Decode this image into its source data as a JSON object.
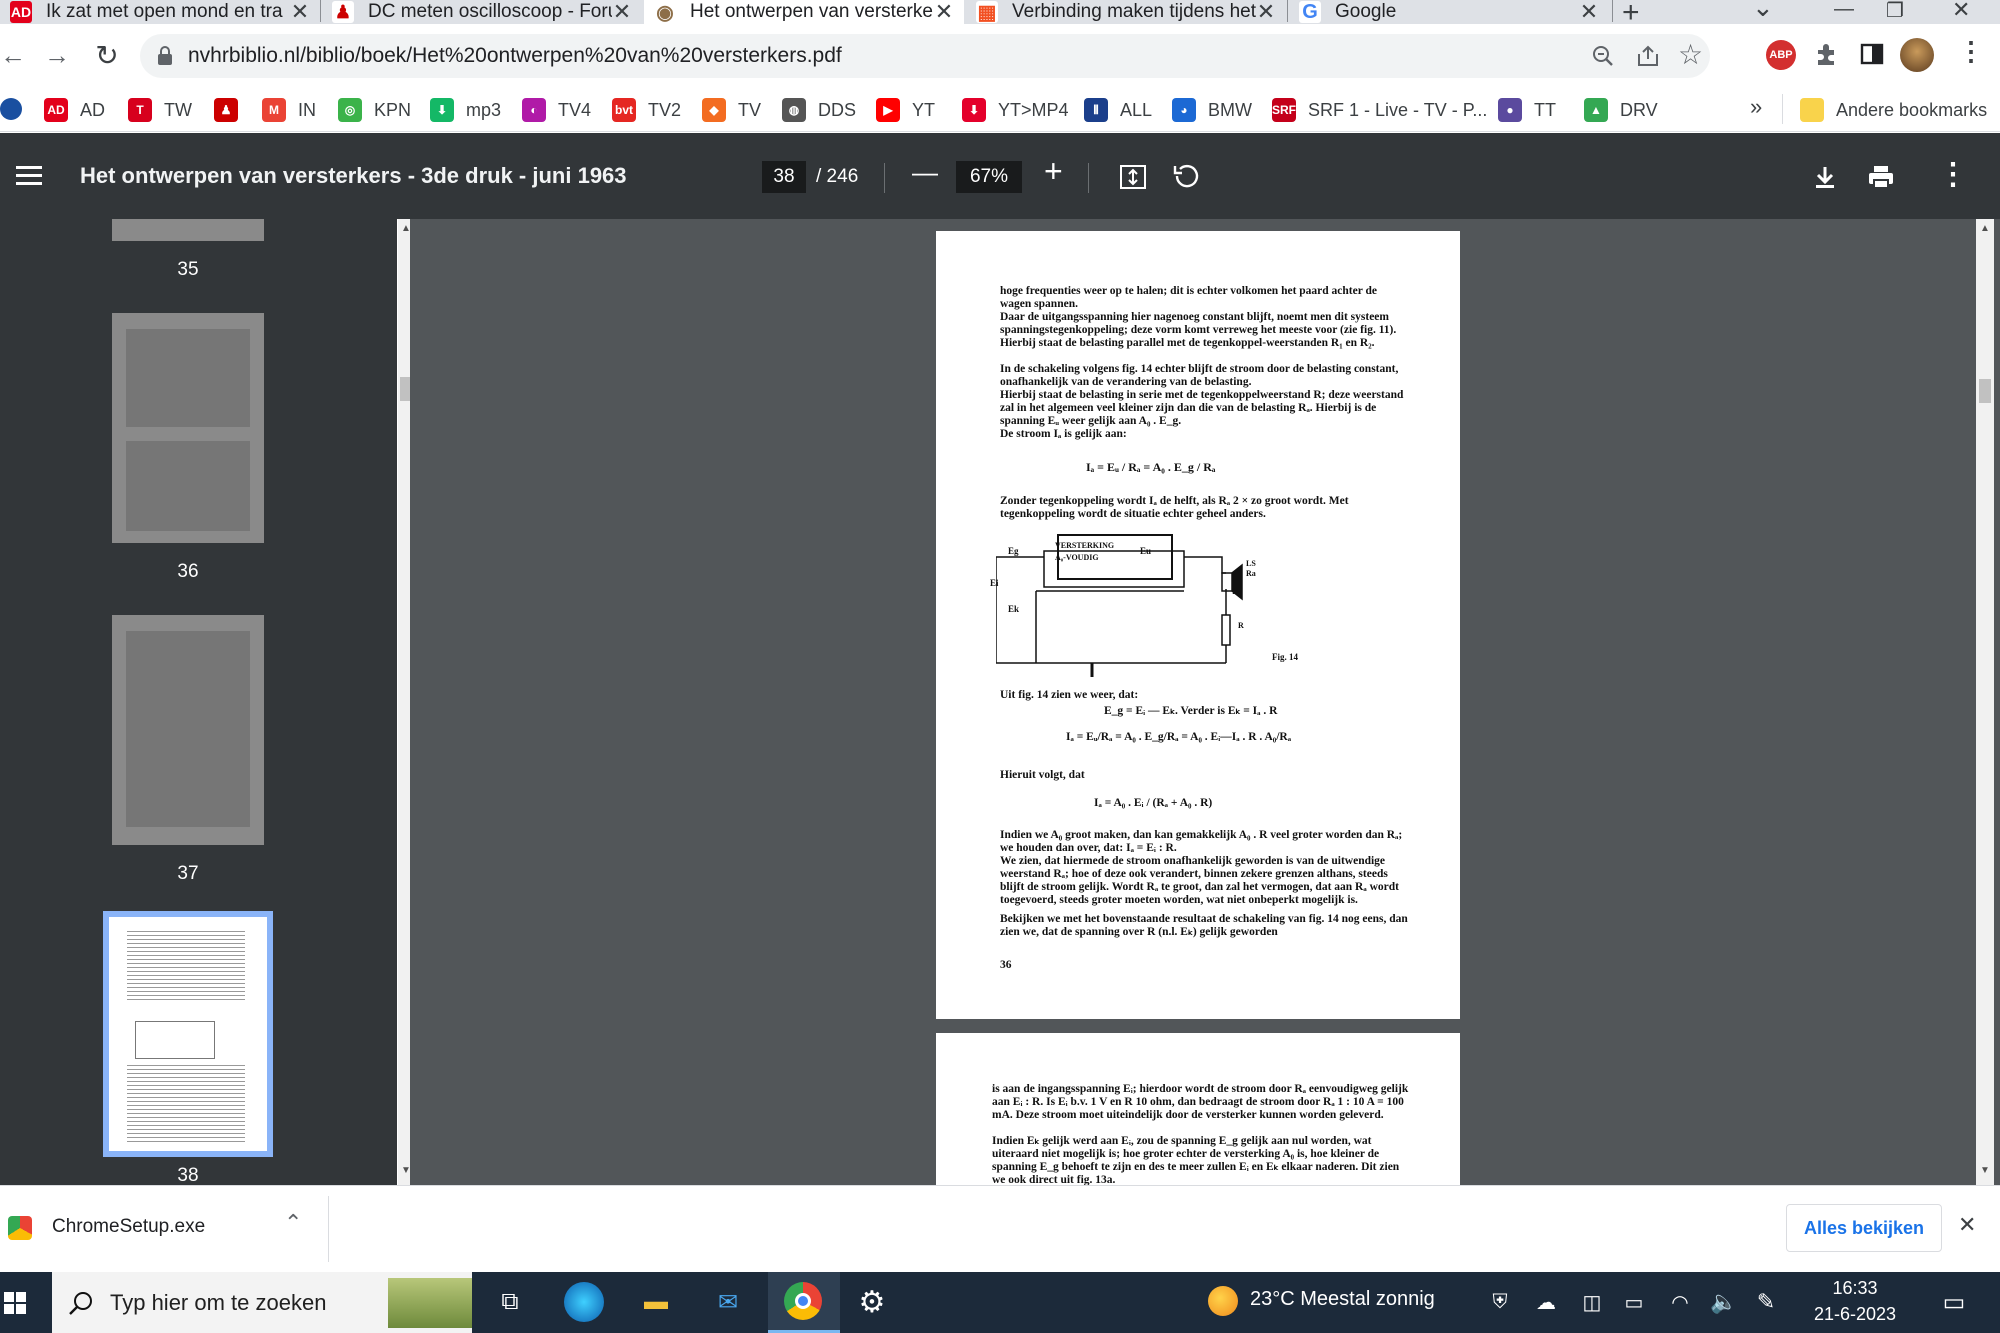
{
  "tabs": [
    {
      "title": "Ik zat met open mond en tra",
      "close": "✕",
      "icon": "AD"
    },
    {
      "title": "DC meten oscilloscoop - Foru",
      "close": "✕",
      "icon": "♟"
    },
    {
      "title": "Het ontwerpen van versterke",
      "close": "✕",
      "icon": "◉"
    },
    {
      "title": "Verbinding maken tijdens het",
      "close": "✕",
      "icon": "▦"
    },
    {
      "title": "Google",
      "close": "✕",
      "icon": "G"
    }
  ],
  "window_controls": {
    "new_tab": "+",
    "dropdown": "⌄",
    "minimize": "—",
    "restore": "❐",
    "close": "✕"
  },
  "nav": {
    "back": "←",
    "forward": "→",
    "reload": "↻",
    "url": "nvhrbiblio.nl/biblio/boek/Het%20ontwerpen%20van%20versterkers.pdf"
  },
  "bookmarks": [
    {
      "label": "AD",
      "color": "#e3001b",
      "icon": "AD"
    },
    {
      "label": "TW",
      "color": "#d7001d",
      "icon": "T"
    },
    {
      "label": "",
      "color": "#cc0000",
      "icon": "♟"
    },
    {
      "label": "IN",
      "color": "#ea4335",
      "icon": "M"
    },
    {
      "label": "KPN",
      "color": "#3bb34a",
      "icon": "◎"
    },
    {
      "label": "mp3",
      "color": "#14b866",
      "icon": "⬇"
    },
    {
      "label": "TV4",
      "color": "#b01aa7",
      "icon": "◐"
    },
    {
      "label": "TV2",
      "color": "#e52722",
      "icon": "bvt"
    },
    {
      "label": "TV",
      "color": "#f36c21",
      "icon": "◆"
    },
    {
      "label": "DDS",
      "color": "#555555",
      "icon": "◍"
    },
    {
      "label": "YT",
      "color": "#ff0000",
      "icon": "▶"
    },
    {
      "label": "YT>MP4",
      "color": "#e4002b",
      "icon": "⬇"
    },
    {
      "label": "ALL",
      "color": "#1b3f8b",
      "icon": "⦀"
    },
    {
      "label": "BMW",
      "color": "#1c69d4",
      "icon": "◕"
    },
    {
      "label": "SRF 1 - Live - TV - P...",
      "color": "#c4001a",
      "icon": "SRF"
    },
    {
      "label": "TT",
      "color": "#5b4a9e",
      "icon": "●"
    },
    {
      "label": "DRV",
      "color": "#34a853",
      "icon": "▲"
    }
  ],
  "bookmarks_more": "»",
  "other_bookmarks": "Andere bookmarks",
  "pdf": {
    "title": "Het ontwerpen van versterkers - 3de druk - juni 1963",
    "page_current": "38",
    "page_total": "/ 246",
    "zoom": "67%",
    "zoom_out": "—",
    "zoom_in": "+"
  },
  "thumbnails": [
    {
      "label": "35"
    },
    {
      "label": "36"
    },
    {
      "label": "37"
    },
    {
      "label": "38"
    }
  ],
  "page38": {
    "p1": "hoge frequenties weer op te halen; dit is echter volkomen het paard achter de wagen spannen.",
    "p2": "Daar de uitgangsspanning hier nagenoeg constant blijft, noemt men dit systeem spanningstegenkoppeling; deze vorm komt verreweg het meeste voor (zie fig. 11). Hierbij staat de belasting parallel met de tegenkoppel-weerstanden R₁ en R₂.",
    "p3": "In de schakeling volgens fig. 14 echter blijft de stroom door de belasting constant, onafhankelijk van de verandering van de belasting.",
    "p4": "Hierbij staat de belasting in serie met de tegenkoppelweerstand R; deze weerstand zal in het algemeen veel kleiner zijn dan die van de belasting Rₐ. Hierbij is de spanning Eᵤ weer gelijk aan A₀ . E_g.",
    "p5": "De stroom Iₐ is gelijk aan:",
    "f1": "Iₐ = Eᵤ / Rₐ = A₀ . E_g / Rₐ",
    "p6": "Zonder tegenkoppeling wordt Iₐ de helft, als Rₐ 2 × zo groot wordt. Met tegenkoppeling wordt de situatie echter geheel anders.",
    "fig_box": "VERSTERKING",
    "fig_box2": "A₀-VOUDIG",
    "fig_eg": "Eg",
    "fig_eu": "Eu",
    "fig_ei": "Ei",
    "fig_ek": "Ek",
    "fig_ls": "LS",
    "fig_ra": "Ra",
    "fig_ia": "Ia",
    "fig_r": "R",
    "fig_caption": "Fig. 14",
    "p7": "Uit fig. 14 zien we weer, dat:",
    "f2": "E_g = Eᵢ — Eₖ. Verder is Eₖ = Iₐ . R",
    "f3": "Iₐ = Eᵤ/Rₐ = A₀ . E_g/Rₐ = A₀ . Eᵢ—Iₐ . R . A₀/Rₐ",
    "p8": "Hieruit volgt, dat",
    "f4": "Iₐ = A₀ . Eᵢ / (Rₐ + A₀ . R)",
    "p9": "Indien we A₀ groot maken, dan kan gemakkelijk A₀ . R veel groter worden dan Rₐ; we houden dan over, dat: Iₐ = Eᵢ : R.",
    "p10": "We zien, dat hiermede de stroom onafhankelijk geworden is van de uitwendige weerstand Rₐ; hoe of deze ook verandert, binnen zekere grenzen althans, steeds blijft de stroom gelijk. Wordt Rₐ te groot, dan zal het vermogen, dat aan Rₐ wordt toegevoerd, steeds groter moeten worden, wat niet onbeperkt mogelijk is.",
    "p11": "Bekijken we met het bovenstaande resultaat de schakeling van fig. 14 nog eens, dan zien we, dat de spanning over R (n.l. Eₖ) gelijk geworden",
    "pagenum": "36"
  },
  "page39": {
    "p1": "is aan de ingangsspanning Eᵢ; hierdoor wordt de stroom door Rₐ eenvoudigweg gelijk aan Eᵢ : R. Is Eᵢ b.v. 1 V en R 10 ohm, dan bedraagt de stroom door Rₐ 1 : 10 A = 100 mA. Deze stroom moet uiteindelijk door de versterker kunnen worden geleverd.",
    "p2": "Indien Eₖ gelijk werd aan Eᵢ, zou de spanning E_g gelijk aan nul worden, wat uiteraard niet mogelijk is; hoe groter echter de versterking A₀ is, hoe kleiner de spanning E_g behoeft te zijn en des te meer zullen Eᵢ en Eₖ elkaar naderen. Dit zien we ook direct uit fig. 13a."
  },
  "download": {
    "filename": "ChromeSetup.exe",
    "show_all": "Alles bekijken",
    "close": "✕"
  },
  "taskbar": {
    "search_placeholder": "Typ hier om te zoeken",
    "weather": "23°C  Meestal zonnig",
    "time": "16:33",
    "date": "21-6-2023"
  }
}
